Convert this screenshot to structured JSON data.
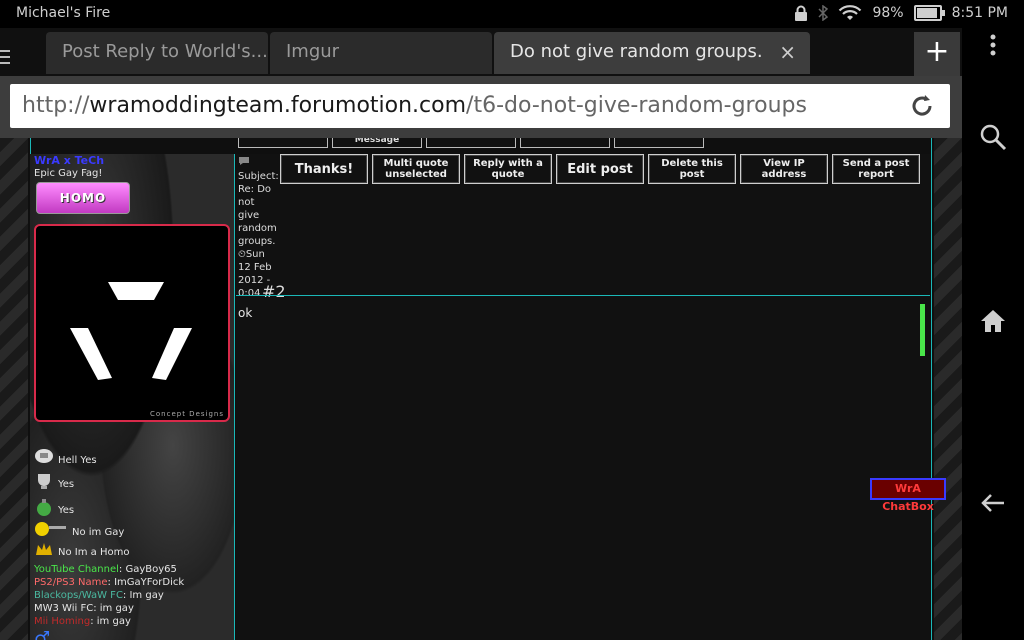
{
  "status_bar": {
    "device_name": "Michael's Fire",
    "battery": "98%",
    "battery_level": 0.98,
    "time": "8:51 PM"
  },
  "tabs": [
    {
      "label": "Post Reply to World's..."
    },
    {
      "label": "Imgur"
    },
    {
      "label": "Do not give random groups.",
      "close": "×"
    }
  ],
  "new_tab_label": "+",
  "address_bar": {
    "scheme": "http://",
    "host": "wramoddingteam.forumotion.com",
    "path": "/t6-do-not-give-random-groups"
  },
  "top_buttons": [
    {
      "label": ""
    },
    {
      "label": "Message"
    },
    {
      "label": ""
    },
    {
      "label": ""
    },
    {
      "label": ""
    }
  ],
  "profile": {
    "username": "WrA x TeCh",
    "title": "Epic Gay Fag!",
    "rank_label": "HOMO",
    "avatar_credit": "Concept Designs",
    "medals": [
      "Hell Yes",
      "Yes",
      "Yes",
      "No im Gay",
      "No Im a Homo"
    ],
    "fields": [
      {
        "key": "YouTube Channel",
        "value": "GayBoy65",
        "color": "#4ae64a"
      },
      {
        "key": "PS2/PS3 Name",
        "value": "ImGaYForDick",
        "color": "#ff6a6a"
      },
      {
        "key": "Blackops/WaW FC",
        "value": "Im gay",
        "color": "#4ab8a0"
      },
      {
        "key": "MW3 Wii FC",
        "value": "im gay",
        "color": "#e6e6e6"
      },
      {
        "key": "Mii Homing",
        "value": "im gay",
        "color": "#c02a2a"
      }
    ],
    "sex_symbol": "♂"
  },
  "post": {
    "subject_lines": [
      "Subject:",
      "Re: Do",
      "not give",
      "random",
      "groups."
    ],
    "date_lines": [
      "Sun",
      "12 Feb",
      "2012 -",
      "0:04"
    ],
    "post_number": "#2",
    "buttons": [
      {
        "label": "Thanks!",
        "big": true
      },
      {
        "label": "Multi quote unselected"
      },
      {
        "label": "Reply with a quote"
      },
      {
        "label": "Edit post",
        "big": true
      },
      {
        "label": "Delete this post"
      },
      {
        "label": "View IP address"
      },
      {
        "label": "Send a post report"
      }
    ],
    "body": "ok"
  },
  "chatbox_label": "WrA ChatBox",
  "colors": {
    "accent": "#1bb8b8",
    "chatbox_border": "#3a3aff",
    "avatar_border": "#d82a4a"
  }
}
